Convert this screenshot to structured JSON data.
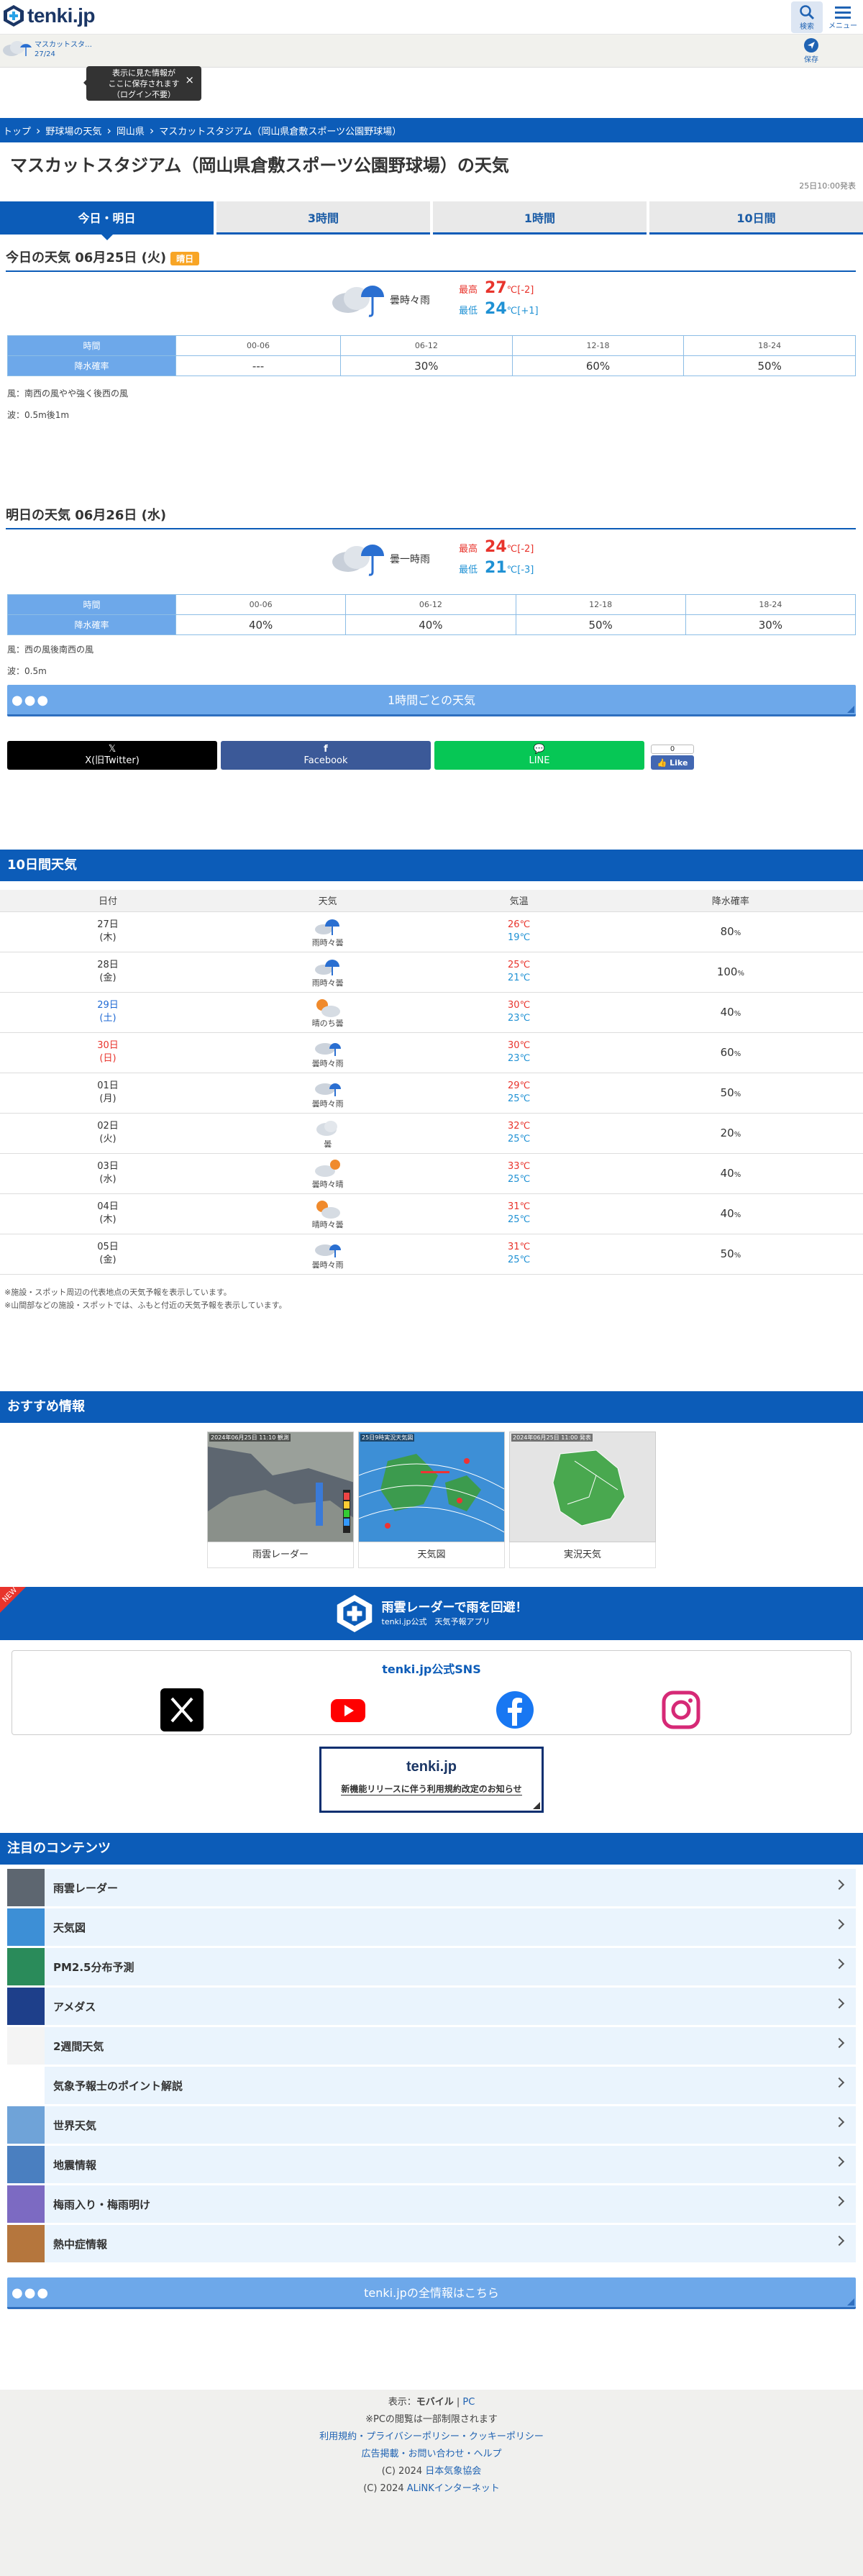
{
  "header": {
    "logo_text": "tenki.jp",
    "search_label": "検索",
    "menu_label": "メニュー"
  },
  "saved": {
    "name": "マスカットスタ…",
    "temp": "27/24",
    "tooltip": [
      "表示に見た情報が",
      "ここに保存されます",
      "（ログイン不要）"
    ],
    "tooltip_close": "×",
    "rank_label": "保存"
  },
  "breadcrumb": [
    "トップ",
    "野球場の天気",
    "岡山県",
    "マスカットスタジアム（岡山県倉敷スポーツ公園野球場）"
  ],
  "title": "マスカットスタジアム（岡山県倉敷スポーツ公園野球場）の天気",
  "updated": "25日10:00発表",
  "tabs": [
    "今日・明日",
    "3時間",
    "1時間",
    "10日間"
  ],
  "today": {
    "heading": "今日の天気 06月25日 (火)",
    "badge": "晴日",
    "weather": "曇時々雨",
    "hi_label": "最高",
    "hi": "27",
    "hi_unit": "℃",
    "hi_diff": "[-2]",
    "lo_label": "最低",
    "lo": "24",
    "lo_unit": "℃",
    "lo_diff": "[+1]",
    "row1_label": "時間",
    "row2_label": "降水確率",
    "times": [
      "00-06",
      "06-12",
      "12-18",
      "18-24"
    ],
    "probs": [
      "---",
      "30%",
      "60%",
      "50%"
    ],
    "wind": "風：南西の風やや強く後西の風",
    "wave": "波：0.5m後1m"
  },
  "tomorrow": {
    "heading": "明日の天気 06月26日 (水)",
    "weather": "曇一時雨",
    "hi_label": "最高",
    "hi": "24",
    "hi_unit": "℃",
    "hi_diff": "[-2]",
    "lo_label": "最低",
    "lo": "21",
    "lo_unit": "℃",
    "lo_diff": "[-3]",
    "row1_label": "時間",
    "row2_label": "降水確率",
    "times": [
      "00-06",
      "06-12",
      "12-18",
      "18-24"
    ],
    "probs": [
      "40%",
      "40%",
      "50%",
      "30%"
    ],
    "wind": "風：西の風後南西の風",
    "wave": "波：0.5m"
  },
  "hourly_button": "1時間ごとの天気",
  "share": {
    "x": "X(旧Twitter)",
    "facebook": "Facebook",
    "line": "LINE",
    "like_count": "0",
    "like": "Like"
  },
  "tenday": {
    "heading": "10日間天気",
    "cols": [
      "日付",
      "天気",
      "気温",
      "降水確率"
    ],
    "rows": [
      {
        "date": "27日",
        "dow": "(木)",
        "type": "",
        "weather": "雨時々曇",
        "hi": "26℃",
        "lo": "19℃",
        "prob": "80",
        "icon": "rain"
      },
      {
        "date": "28日",
        "dow": "(金)",
        "type": "",
        "weather": "雨時々曇",
        "hi": "25℃",
        "lo": "21℃",
        "prob": "100",
        "icon": "rain"
      },
      {
        "date": "29日",
        "dow": "(土)",
        "type": "sat",
        "weather": "晴のち曇",
        "hi": "30℃",
        "lo": "23℃",
        "prob": "40",
        "icon": "suncloud"
      },
      {
        "date": "30日",
        "dow": "(日)",
        "type": "sun",
        "weather": "曇時々雨",
        "hi": "30℃",
        "lo": "23℃",
        "prob": "60",
        "icon": "cloudrain"
      },
      {
        "date": "01日",
        "dow": "(月)",
        "type": "",
        "weather": "曇時々雨",
        "hi": "29℃",
        "lo": "25℃",
        "prob": "50",
        "icon": "cloudrain"
      },
      {
        "date": "02日",
        "dow": "(火)",
        "type": "",
        "weather": "曇",
        "hi": "32℃",
        "lo": "25℃",
        "prob": "20",
        "icon": "cloud"
      },
      {
        "date": "03日",
        "dow": "(水)",
        "type": "",
        "weather": "曇時々晴",
        "hi": "33℃",
        "lo": "25℃",
        "prob": "40",
        "icon": "cloudsun"
      },
      {
        "date": "04日",
        "dow": "(木)",
        "type": "",
        "weather": "晴時々曇",
        "hi": "31℃",
        "lo": "25℃",
        "prob": "40",
        "icon": "suncloud"
      },
      {
        "date": "05日",
        "dow": "(金)",
        "type": "",
        "weather": "曇時々雨",
        "hi": "31℃",
        "lo": "25℃",
        "prob": "50",
        "icon": "cloudrain"
      }
    ],
    "prob_unit": "%",
    "notes": [
      "※施設・スポット周辺の代表地点の天気予報を表示しています。",
      "※山間部などの施設・スポットでは、ふもと付近の天気予報を表示しています。"
    ]
  },
  "recommend": {
    "heading": "おすすめ情報",
    "items": [
      "雨雲レーダー",
      "天気図",
      "実況天気"
    ],
    "radar_stamp": "2024年06月25日 11:10 観測",
    "chart_stamp": "25日9時実況天気図",
    "live_stamp": "2024年06月25日 11:00 発表"
  },
  "banner": {
    "new": "NEW",
    "title": "雨雲レーダーで雨を回避！",
    "sub": "tenki.jp公式　天気予報アプリ"
  },
  "official_sns": {
    "title": "tenki.jp公式SNS"
  },
  "notice": {
    "logo": "tenki.jp",
    "text": "新機能リリースに伴う利用規約改定のお知らせ"
  },
  "featured": {
    "heading": "注目のコンテンツ",
    "items": [
      "雨雲レーダー",
      "天気図",
      "PM2.5分布予測",
      "アメダス",
      "2週間天気",
      "気象予報士のポイント解説",
      "世界天気",
      "地震情報",
      "梅雨入り・梅雨明け",
      "熱中症情報"
    ]
  },
  "all_info_button": "tenki.jpの全情報はこちら",
  "footer": {
    "display": "表示：",
    "mobile": "モバイル",
    "sep": " | ",
    "pc": "PC",
    "pc_note": "※PCの閲覧は一部制限されます",
    "links": "利用規約・プライバシーポリシー・クッキーポリシー",
    "links2": "広告掲載・お問い合わせ・ヘルプ",
    "copy1": "(C) 2024 ",
    "copy1_link": "日本気象協会",
    "copy2": "(C) 2024 ",
    "copy2_link": "ALiNKインターネット"
  },
  "colors": {
    "brand": "#0c5cb8",
    "high": "#e8342c",
    "low": "#1f91d4",
    "table_head": "#6da8ea"
  }
}
